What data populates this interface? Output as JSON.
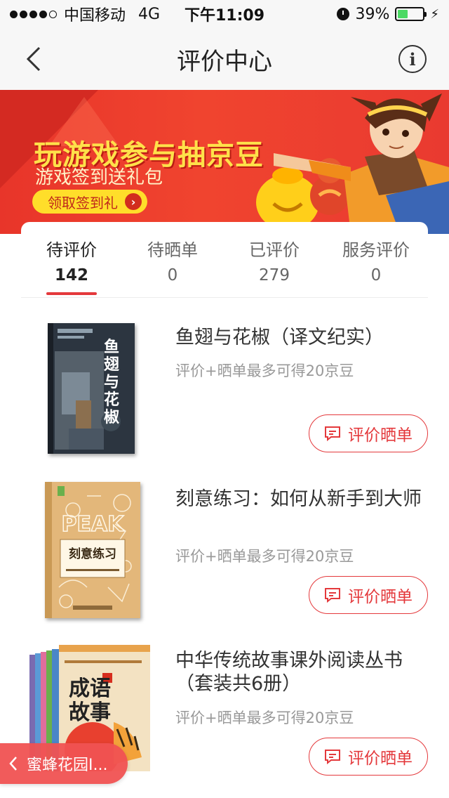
{
  "status_bar": {
    "carrier": "中国移动",
    "network": "4G",
    "time": "下午11:09",
    "battery": "39%",
    "battery_level": 0.39
  },
  "nav": {
    "title": "评价中心"
  },
  "banner": {
    "headline": "玩游戏参与抽京豆",
    "subtitle": "游戏签到送礼包",
    "cta_label": "领取签到礼",
    "slide_count": 3,
    "active_slide": 3
  },
  "tabs": [
    {
      "label": "待评价",
      "count": "142"
    },
    {
      "label": "待晒单",
      "count": "0"
    },
    {
      "label": "已评价",
      "count": "279"
    },
    {
      "label": "服务评价",
      "count": "0"
    }
  ],
  "products": [
    {
      "title": "鱼翅与花椒（译文纪实）",
      "subtitle": "评价+晒单最多可得20京豆",
      "button_label": "评价晒单",
      "cover_text": "鱼翅与花椒"
    },
    {
      "title": "刻意练习：如何从新手到大师",
      "subtitle": "评价+晒单最多可得20京豆",
      "button_label": "评价晒单",
      "cover_text": "刻意练习",
      "cover_word": "PEAK"
    },
    {
      "title": "中华传统故事课外阅读丛书（套装共6册）",
      "subtitle": "评价+晒单最多可得20京豆",
      "button_label": "评价晒单",
      "cover_text": "成语故事"
    }
  ],
  "float_back": {
    "label": "蜜蜂花园I..."
  },
  "colors": {
    "accent": "#e4393c",
    "banner_red": "#e8352a",
    "banner_yellow": "#ffe14a"
  }
}
